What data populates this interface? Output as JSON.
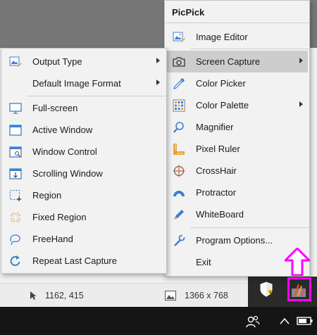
{
  "main_menu": {
    "title": "PicPick",
    "items": [
      {
        "label": "Image Editor",
        "icon": "image-editor-icon"
      },
      {
        "label": "Screen Capture",
        "icon": "camera-icon",
        "submenu": true,
        "highlighted": true
      },
      {
        "label": "Color Picker",
        "icon": "eyedropper-icon"
      },
      {
        "label": "Color Palette",
        "icon": "palette-icon",
        "submenu": true
      },
      {
        "label": "Magnifier",
        "icon": "magnifier-icon"
      },
      {
        "label": "Pixel Ruler",
        "icon": "ruler-icon"
      },
      {
        "label": "CrossHair",
        "icon": "crosshair-icon"
      },
      {
        "label": "Protractor",
        "icon": "protractor-icon"
      },
      {
        "label": "WhiteBoard",
        "icon": "pen-icon"
      },
      {
        "label": "Program Options...",
        "icon": "wrench-icon"
      },
      {
        "label": "Exit",
        "icon": ""
      }
    ]
  },
  "capture_submenu": {
    "items": [
      {
        "label": "Output Type",
        "icon": "output-icon",
        "submenu": true
      },
      {
        "label": "Default Image Format",
        "icon": "",
        "submenu": true
      },
      {
        "label": "Full-screen",
        "icon": "monitor-icon"
      },
      {
        "label": "Active Window",
        "icon": "window-icon"
      },
      {
        "label": "Window Control",
        "icon": "window-control-icon"
      },
      {
        "label": "Scrolling Window",
        "icon": "scroll-window-icon"
      },
      {
        "label": "Region",
        "icon": "region-icon"
      },
      {
        "label": "Fixed Region",
        "icon": "fixed-region-icon"
      },
      {
        "label": "FreeHand",
        "icon": "freehand-icon"
      },
      {
        "label": "Repeat Last Capture",
        "icon": "repeat-icon"
      }
    ]
  },
  "status_bar": {
    "cursor_position": "1162, 415",
    "image_size": "1366 x 768"
  },
  "colors": {
    "accent_pink": "#ff00ff",
    "icon_blue": "#3d7fd0",
    "icon_orange": "#e8a33a"
  }
}
